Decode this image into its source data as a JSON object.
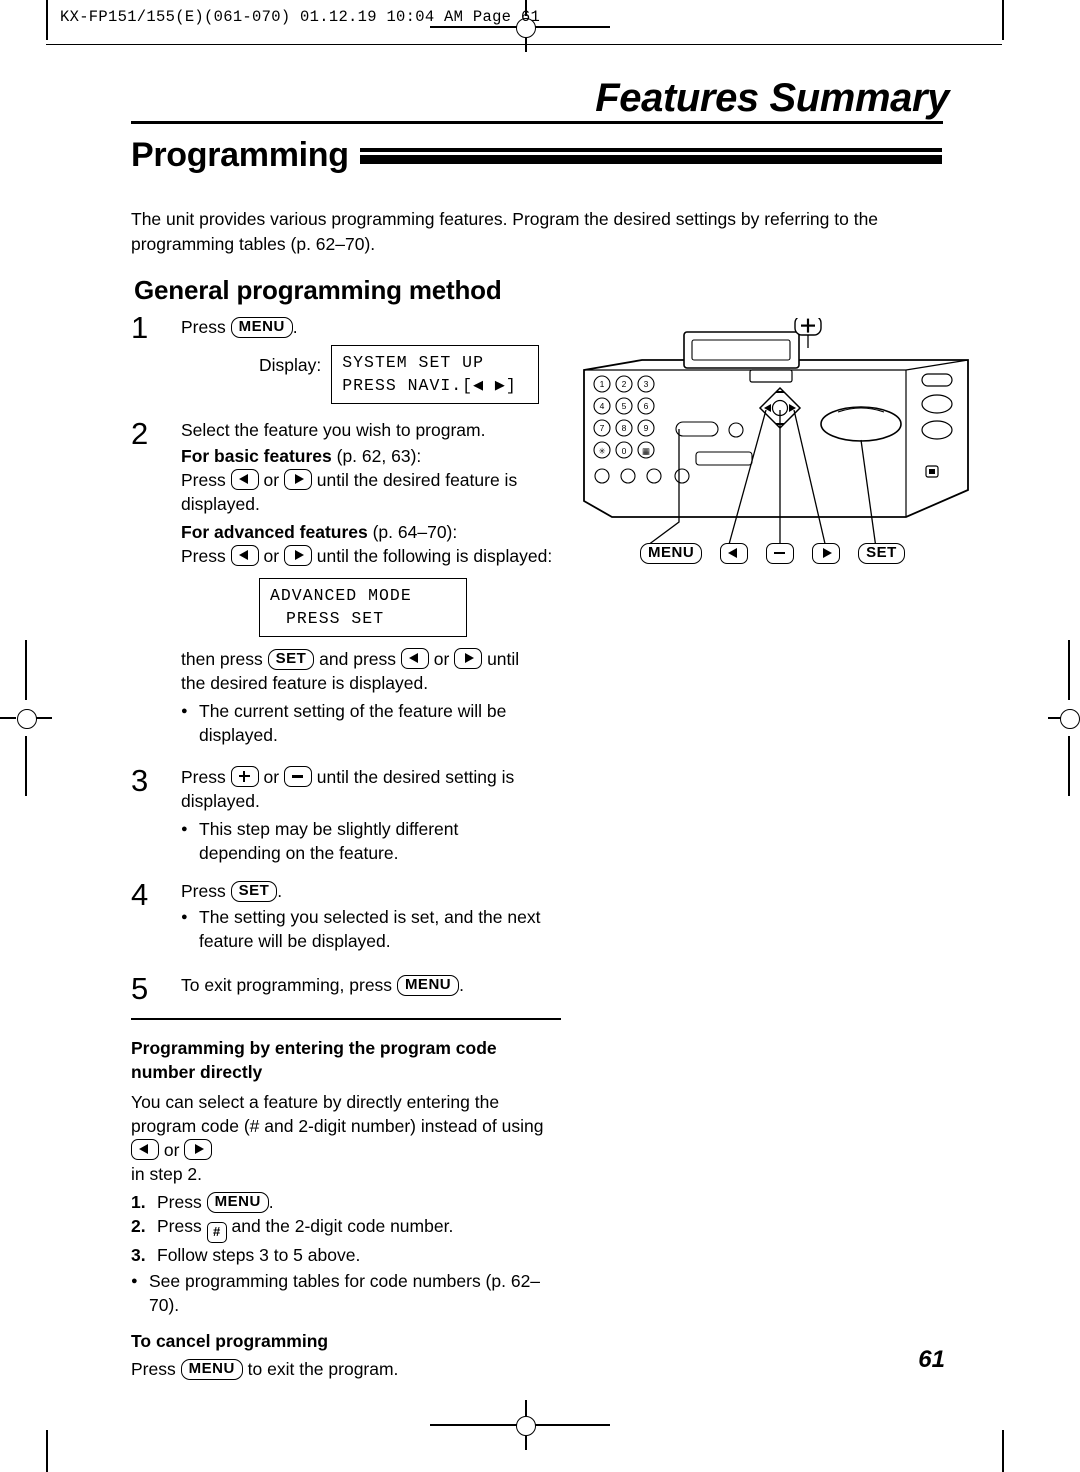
{
  "header": {
    "code_line": "KX-FP151/155(E)(061-070)  01.12.19 10:04 AM  Page 61"
  },
  "titles": {
    "running_head": "Features Summary",
    "chapter": "Programming",
    "section": "General programming method"
  },
  "intro": "The unit provides various programming features. Program the desired settings by referring to the programming tables (p. 62–70).",
  "steps": {
    "s1": {
      "num": "1",
      "press": "Press",
      "key_menu": "MENU",
      "period": ".",
      "display_label": "Display:",
      "lcd_line1": "SYSTEM SET UP",
      "lcd_line2": "PRESS NAVI.[◀ ▶]"
    },
    "s2": {
      "num": "2",
      "line1": "Select the feature you wish to program.",
      "basic_bold": "For basic features",
      "basic_rest": "(p. 62, 63):",
      "basic_press": "Press",
      "or": "or",
      "basic_tail": "until the desired feature is displayed.",
      "adv_bold": "For advanced features",
      "adv_rest": "(p. 64–70):",
      "adv_press": "Press",
      "adv_tail": "until the following is displayed:",
      "lcd_line1": "ADVANCED MODE",
      "lcd_line2": "PRESS SET",
      "then_press": "then press",
      "key_set": "SET",
      "and_press": "and press",
      "until": "until",
      "tail2": "the desired feature is displayed.",
      "bullet": "The current setting of the feature will be displayed."
    },
    "s3": {
      "num": "3",
      "press": "Press",
      "or": "or",
      "tail": "until the desired setting is displayed.",
      "bullet": "This step may be slightly different depending on the feature."
    },
    "s4": {
      "num": "4",
      "press": "Press",
      "key_set": "SET",
      "period": ".",
      "bullet": "The setting you selected is set, and the next feature will be displayed."
    },
    "s5": {
      "num": "5",
      "text": "To exit programming, press",
      "key_menu": "MENU",
      "period": "."
    }
  },
  "bottom": {
    "heading_line1": "Programming by entering the program code",
    "heading_line2": "number directly",
    "para_a": "You can select a feature by directly entering the program code (# and 2-digit number) instead of using",
    "para_or": "or",
    "para_b": "in step 2.",
    "items": [
      {
        "n": "1.",
        "text_before": "Press",
        "key": "MENU",
        "text_after": "."
      },
      {
        "n": "2.",
        "text_before": "Press",
        "key": "#",
        "text_after": "and the 2-digit code number."
      },
      {
        "n": "3.",
        "text_before": "Follow steps 3 to 5 above.",
        "key": "",
        "text_after": ""
      }
    ],
    "bullet": "See programming tables for code numbers (p. 62–70).",
    "cancel_heading": "To cancel programming",
    "cancel_before": "Press",
    "cancel_key": "MENU",
    "cancel_after": "to exit the program."
  },
  "figure": {
    "caption_keys": [
      "MENU",
      "◀",
      "—",
      "▶",
      "SET"
    ],
    "plus_key": "+",
    "keypad": [
      "1",
      "2",
      "3",
      "4",
      "5",
      "6",
      "7",
      "8",
      "9",
      "✱",
      "0",
      "#"
    ]
  },
  "page_number": "61"
}
